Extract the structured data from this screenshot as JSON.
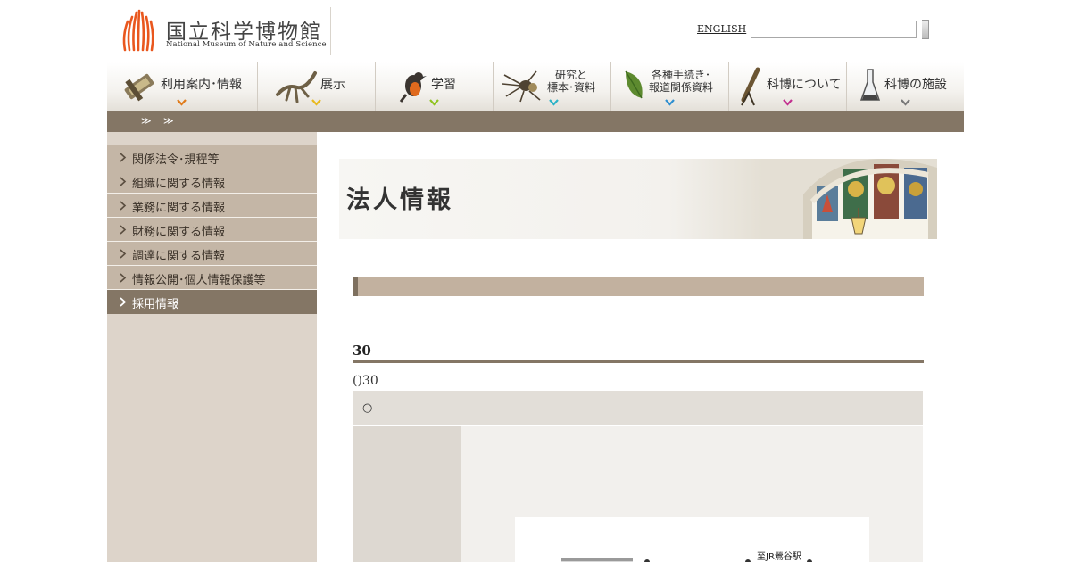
{
  "header": {
    "logo_title": "国立科学博物館",
    "logo_subtitle": "National Museum of Nature and Science",
    "english_link": "ENGLISH",
    "search_placeholder": ""
  },
  "globalnav": {
    "items": [
      {
        "label": "利用案内･情報",
        "arrow_color": "#e07b1a"
      },
      {
        "label": "展示",
        "arrow_color": "#e8b91e"
      },
      {
        "label": "学習",
        "arrow_color": "#8fc31f"
      },
      {
        "label_line1": "研究と",
        "label_line2": "標本･資料",
        "arrow_color": "#2bb3c7"
      },
      {
        "label_line1": "各種手続き･",
        "label_line2": "報道関係資料",
        "arrow_color": "#2f8fd0"
      },
      {
        "label": "科博について",
        "arrow_color": "#c2308f"
      },
      {
        "label": "科博の施設",
        "arrow_color": "#777777"
      }
    ]
  },
  "breadcrumb": {
    "sep1": "≫",
    "sep2": "≫"
  },
  "sidebar": {
    "items": [
      {
        "label": "関係法令･規程等",
        "active": false
      },
      {
        "label": "組織に関する情報",
        "active": false
      },
      {
        "label": "業務に関する情報",
        "active": false
      },
      {
        "label": "財務に関する情報",
        "active": false
      },
      {
        "label": "調達に関する情報",
        "active": false
      },
      {
        "label": "情報公開･個人情報保護等",
        "active": false
      },
      {
        "label": "採用情報",
        "active": true
      }
    ]
  },
  "main": {
    "page_title": "法人情報",
    "heading": "30",
    "note": "()30",
    "table_caption": "○",
    "map_label": "至JR鶯谷駅"
  },
  "colors": {
    "breadcrumb_bg": "#847665",
    "sidebar_item_bg": "#c4b6a6",
    "sidebar_active_bg": "#847665",
    "section_bar_bg": "#c2b19f"
  }
}
